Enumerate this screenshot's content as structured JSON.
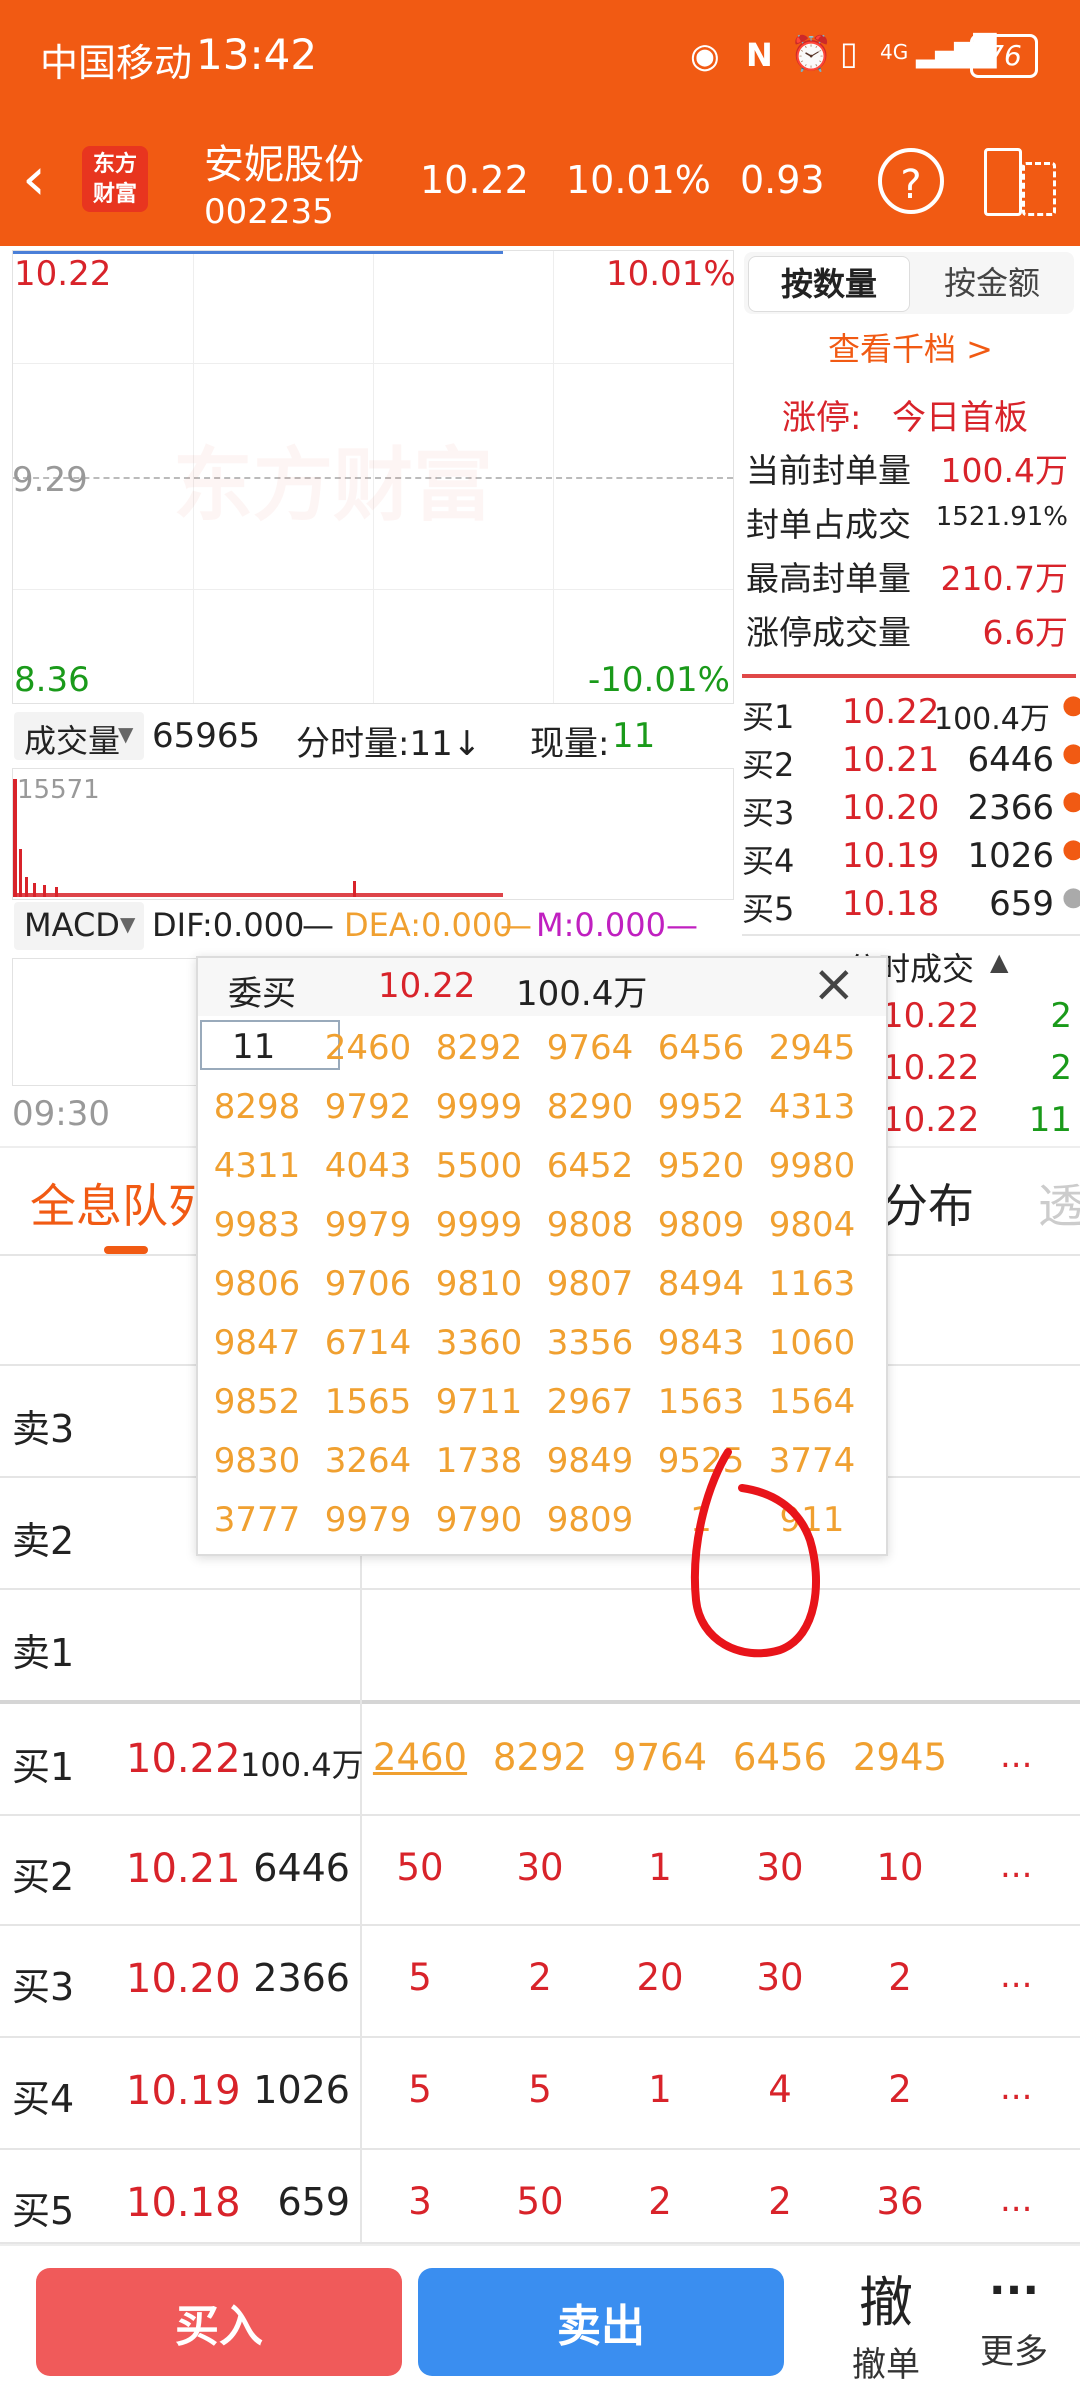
{
  "status_bar": {
    "carrier": "中国移动",
    "time": "13:42",
    "network": "4G",
    "battery": "76"
  },
  "header": {
    "logo_line1": "东方",
    "logo_line2": "财富",
    "stock_name": "安妮股份",
    "stock_code": "002235",
    "price": "10.22",
    "change_pct": "10.01%",
    "change_amt": "0.93",
    "help_icon": "?"
  },
  "chart": {
    "top_price": "10.22",
    "top_pct": "10.01%",
    "mid_price": "9.29",
    "bottom_price": "8.36",
    "bottom_pct": "-10.01%",
    "watermark": "东方财富",
    "volume_label": "成交量",
    "volume_value": "65965",
    "minute_vol_label": "分时量:11↓",
    "current_vol_label": "现量:",
    "current_vol_value": "11",
    "volume_max": "15571",
    "macd_label": "MACD",
    "dif": "DIF:0.000",
    "dea": "DEA:0.000",
    "m": "M:0.000",
    "time_start": "09:30"
  },
  "right_panel": {
    "tab_qty": "按数量",
    "tab_amount": "按金额",
    "view_link": "查看千档 >",
    "limit_label": "涨停:",
    "limit_value": "今日首板",
    "stats": [
      {
        "label": "当前封单量",
        "value": "100.4万"
      },
      {
        "label": "封单占成交",
        "value": "1521.91%"
      },
      {
        "label": "最高封单量",
        "value": "210.7万"
      },
      {
        "label": "涨停成交量",
        "value": "6.6万"
      }
    ],
    "bids": [
      {
        "label": "买1",
        "price": "10.22",
        "vol": "100.4万"
      },
      {
        "label": "买2",
        "price": "10.21",
        "vol": "6446"
      },
      {
        "label": "买3",
        "price": "10.20",
        "vol": "2366"
      },
      {
        "label": "买4",
        "price": "10.19",
        "vol": "1026"
      },
      {
        "label": "买5",
        "price": "10.18",
        "vol": "659"
      }
    ],
    "ticks_title": "分时成交",
    "ticks": [
      {
        "price": "10.22",
        "vol": "2"
      },
      {
        "price": "10.22",
        "vol": "2"
      },
      {
        "price": "10.22",
        "vol": "11"
      }
    ]
  },
  "tabs": {
    "queue": "全息队列",
    "distribution": "分布",
    "faded": "透"
  },
  "queue_table": {
    "sells": [
      "卖3",
      "卖2",
      "卖1"
    ],
    "rows": [
      {
        "label": "买1",
        "price": "10.22",
        "vol": "100.4万",
        "orders": [
          "2460",
          "8292",
          "9764",
          "6456",
          "2945"
        ],
        "more": "..."
      },
      {
        "label": "买2",
        "price": "10.21",
        "vol": "6446",
        "orders": [
          "50",
          "30",
          "1",
          "30",
          "10"
        ],
        "more": "..."
      },
      {
        "label": "买3",
        "price": "10.20",
        "vol": "2366",
        "orders": [
          "5",
          "2",
          "20",
          "30",
          "2"
        ],
        "more": "..."
      },
      {
        "label": "买4",
        "price": "10.19",
        "vol": "1026",
        "orders": [
          "5",
          "5",
          "1",
          "4",
          "2"
        ],
        "more": "..."
      },
      {
        "label": "买5",
        "price": "10.18",
        "vol": "659",
        "orders": [
          "3",
          "50",
          "2",
          "2",
          "36"
        ],
        "more": "..."
      }
    ]
  },
  "popup": {
    "title": "委买",
    "price": "10.22",
    "volume": "100.4万",
    "close": "×",
    "grid": [
      [
        "11",
        "2460",
        "8292",
        "9764",
        "6456",
        "2945"
      ],
      [
        "8298",
        "9792",
        "9999",
        "8290",
        "9952",
        "4313"
      ],
      [
        "4311",
        "4043",
        "5500",
        "6452",
        "9520",
        "9980"
      ],
      [
        "9983",
        "9979",
        "9999",
        "9808",
        "9809",
        "9804"
      ],
      [
        "9806",
        "9706",
        "9810",
        "9807",
        "8494",
        "1163"
      ],
      [
        "9847",
        "6714",
        "3360",
        "3356",
        "9843",
        "1060"
      ],
      [
        "9852",
        "1565",
        "9711",
        "2967",
        "1563",
        "1564"
      ],
      [
        "9830",
        "3264",
        "1738",
        "9849",
        "9525",
        "3774"
      ],
      [
        "3777",
        "9979",
        "9790",
        "9809",
        "1",
        "911"
      ]
    ]
  },
  "bottom_bar": {
    "buy": "买入",
    "sell": "卖出",
    "cancel_icon": "撤",
    "cancel_label": "撤单",
    "more_icon": "···",
    "more_label": "更多"
  },
  "colors": {
    "brand": "#f15a13",
    "up": "#d8232a",
    "down": "#1a9a1a",
    "order": "#f0a030",
    "buy_btn": "#f05a5a",
    "sell_btn": "#3a8ef0"
  }
}
